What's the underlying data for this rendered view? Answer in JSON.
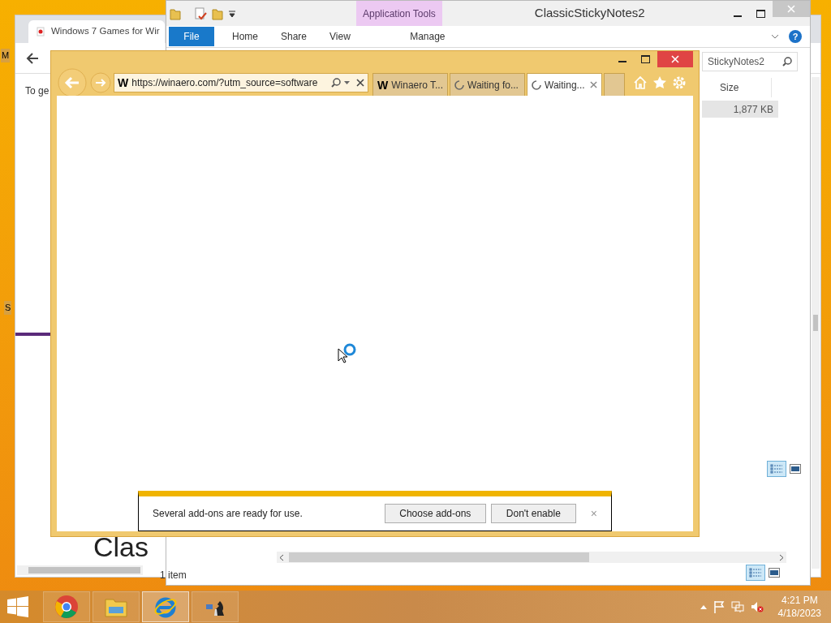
{
  "desktop": {
    "labels": [
      "M",
      "S"
    ]
  },
  "background_browser": {
    "tab_title": "Windows 7 Games for Wir",
    "page_text": "To ge",
    "heading": "Clas"
  },
  "explorer": {
    "title": "ClassicStickyNotes2",
    "context_group": "Application Tools",
    "ribbon_tabs": [
      {
        "label": "File",
        "kind": "file"
      },
      {
        "label": "Home",
        "kind": "tab"
      },
      {
        "label": "Share",
        "kind": "tab"
      },
      {
        "label": "View",
        "kind": "tab"
      },
      {
        "label": "Manage",
        "kind": "context"
      }
    ],
    "help": "?",
    "search": {
      "value": "StickyNotes2"
    },
    "columns": [
      "Size"
    ],
    "rows": [
      {
        "size": "1,877 KB",
        "selected": true
      }
    ],
    "status": "1 item"
  },
  "ie": {
    "address": {
      "site_icon": "W",
      "url": "https://winaero.com/?utm_source=software"
    },
    "tabs": [
      {
        "title": "Winaero T...",
        "kind": "site",
        "favicon": "W",
        "selected": false
      },
      {
        "title": "Waiting fo...",
        "kind": "loading",
        "selected": false
      },
      {
        "title": "Waiting...",
        "kind": "loading",
        "selected": true
      }
    ],
    "notification": {
      "message": "Several add-ons are ready for use.",
      "buttons": [
        "Choose add-ons",
        "Don't enable"
      ],
      "close": "×"
    }
  },
  "taskbar": {
    "apps": [
      {
        "kind": "chrome",
        "selected": false
      },
      {
        "kind": "explorer",
        "selected": false
      },
      {
        "kind": "ie",
        "selected": true
      },
      {
        "kind": "chess",
        "selected": false
      }
    ],
    "time": "4:21 PM",
    "date": "4/18/2023"
  }
}
